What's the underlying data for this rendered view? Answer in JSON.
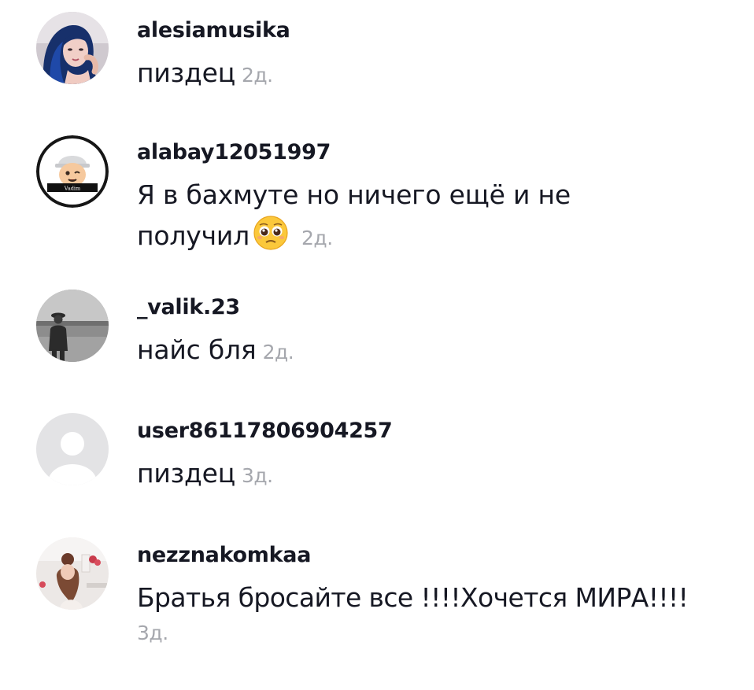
{
  "comments": [
    {
      "username": "alesiamusika",
      "text": "пиздец",
      "time": "2д."
    },
    {
      "username": "alabay12051997",
      "text_line1": "Я в бахмуте но ничего ещё и не",
      "text_line2": "получил",
      "emoji": "pleading-face-emoji",
      "time": "2д.",
      "avatar_caption": "Vadim"
    },
    {
      "username": "_valik.23",
      "text": "найс бля",
      "time": "2д."
    },
    {
      "username": "user86117806904257",
      "text": "пиздец",
      "time": "3д."
    },
    {
      "username": "nezznakomkaa",
      "text": "Братья бросайте все !!!!Хочется МИРА!!!!",
      "time": "3д."
    }
  ],
  "colors": {
    "username": "#161823",
    "text": "#161823",
    "timestamp": "#a5a7ad",
    "default_avatar_bg": "#e3e3e5",
    "default_avatar_fg": "#ffffff"
  }
}
